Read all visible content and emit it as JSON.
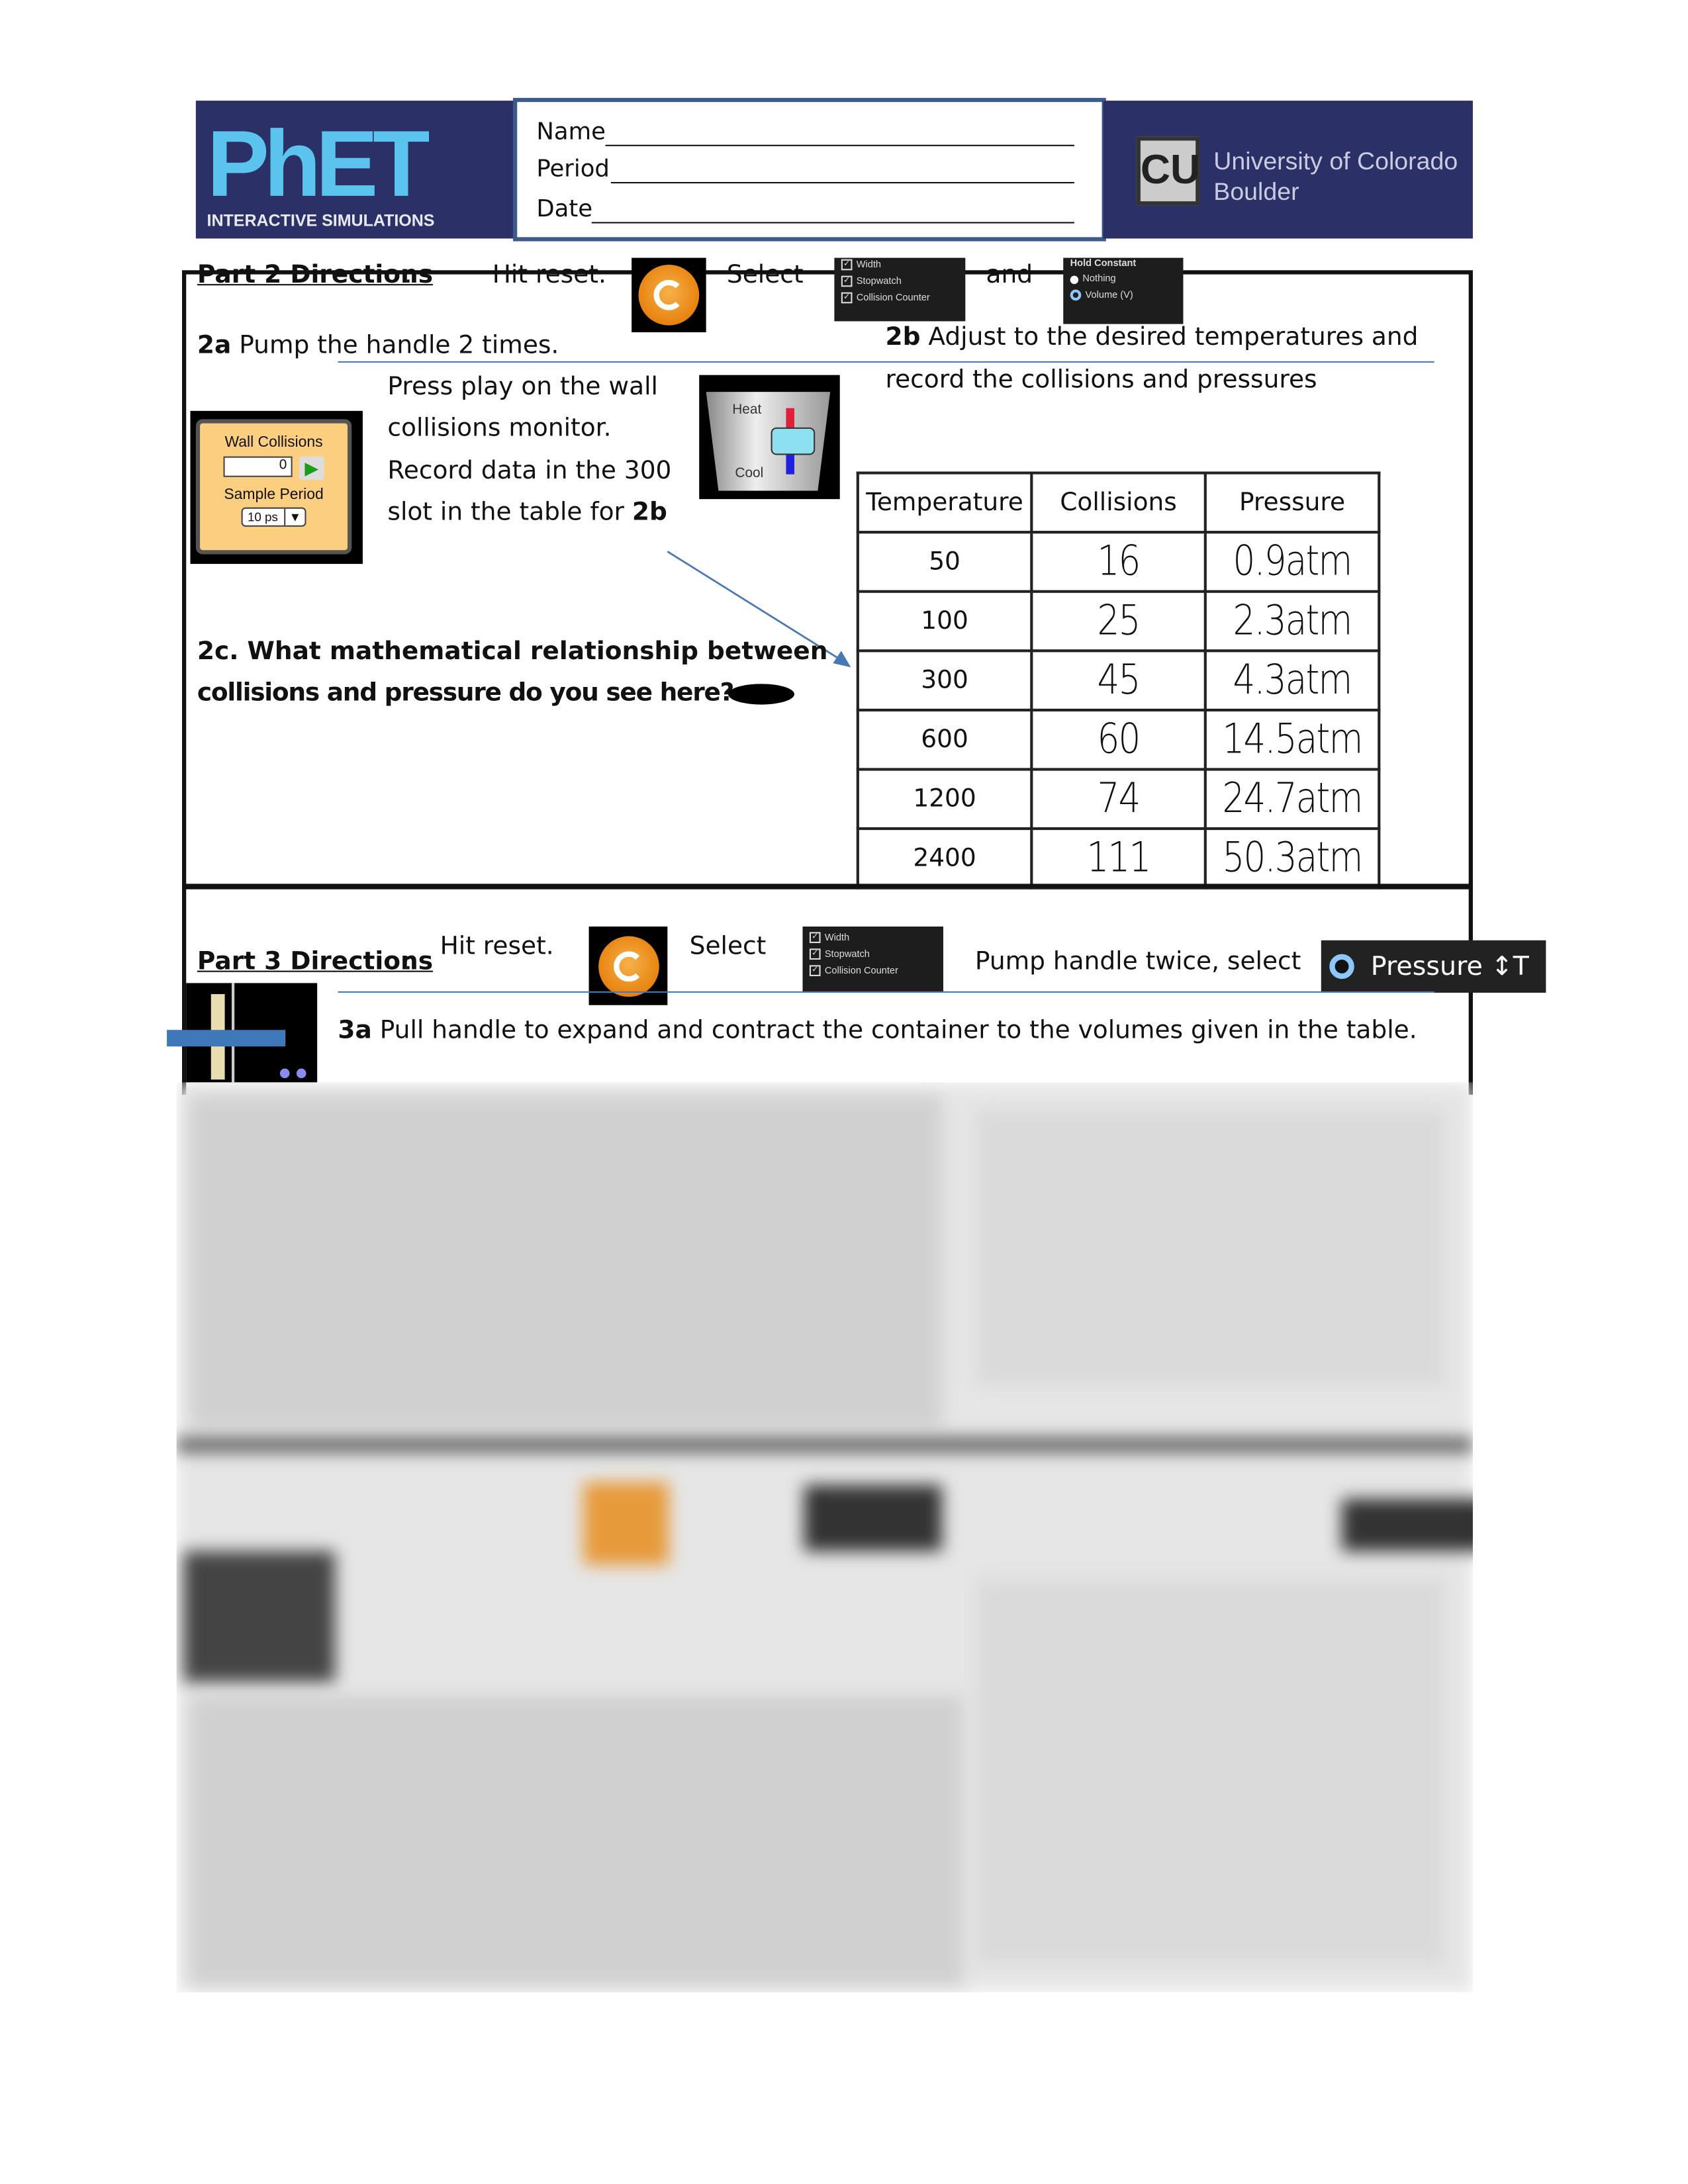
{
  "header": {
    "phet_logo": {
      "text": "PhET",
      "subtitle": "INTERACTIVE SIMULATIONS"
    },
    "form": {
      "name_label": "Name",
      "period_label": "Period",
      "date_label": "Date"
    },
    "cu_logo": {
      "line1": "University of Colorado",
      "line2": "Boulder"
    },
    "colors": {
      "banner": "#2b3166",
      "form_border": "#3d5a8a"
    }
  },
  "part2": {
    "heading": "Part 2 Directions",
    "hit_reset": "Hit reset.",
    "select": "Select",
    "and": "and",
    "checkbox_panel": {
      "items": [
        "Width",
        "Stopwatch",
        "Collision Counter"
      ]
    },
    "hold_constant_panel": {
      "title": "Hold Constant",
      "options": [
        "Nothing",
        "Volume (V)"
      ],
      "selected": "Volume (V)"
    },
    "step_2a_num": "2a",
    "step_2a": " Pump the handle 2 times.",
    "step_2b_num": "2b",
    "step_2b_line1": " Adjust to the desired temperatures and",
    "step_2b_line2": "record the collisions and pressures",
    "wall_collisions": {
      "title": "Wall Collisions",
      "value": "0",
      "sample_label": "Sample Period",
      "sample_value": "10 ps"
    },
    "instructions": [
      "Press play on the wall",
      "collisions monitor.",
      "Record data in the 300",
      "slot in the table for "
    ],
    "instructions_bold": "2b",
    "heat_cool": {
      "heat": "Heat",
      "cool": "Cool"
    },
    "step_2c_line1": "2c. What mathematical relationship between",
    "step_2c_line2": "collisions and pressure do you see here?",
    "table": {
      "headers": [
        "Temperature",
        "Collisions",
        "Pressure"
      ],
      "rows": [
        [
          "50",
          "16",
          "0.9atm"
        ],
        [
          "100",
          "25",
          "2.3atm"
        ],
        [
          "300",
          "45",
          "4.3atm"
        ],
        [
          "600",
          "60",
          "14.5atm"
        ],
        [
          "1200",
          "74",
          "24.7atm"
        ],
        [
          "2400",
          "111",
          "50.3atm"
        ]
      ]
    }
  },
  "part3": {
    "heading": "Part 3 Directions",
    "hit_reset": "Hit reset.",
    "select": "Select",
    "checkbox_panel": {
      "items": [
        "Width",
        "Stopwatch",
        "Collision Counter"
      ]
    },
    "pump": "Pump handle twice, select",
    "pressure_option": "Pressure ↕T",
    "step_3a_num": "3a",
    "step_3a": " Pull handle to expand and contract the container to the volumes given in the table."
  }
}
